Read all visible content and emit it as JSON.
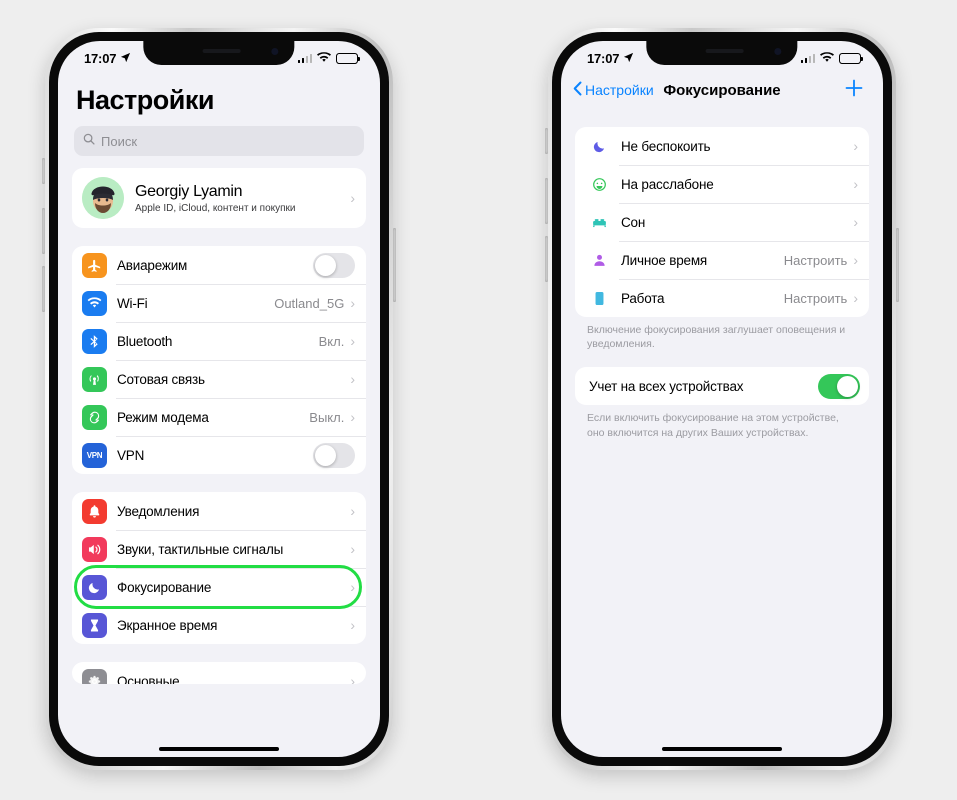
{
  "canvas": {
    "background": "#eeeeee"
  },
  "accent": {
    "blue": "#0a84ff",
    "green": "#34c759",
    "highlight": "#22dd44"
  },
  "phones": [
    {
      "id": "left",
      "status_bar": {
        "time": "17:07",
        "location_icon": "location-arrow-icon",
        "signal": "cellular-bars-icon",
        "wifi": "wifi-icon",
        "battery": "battery-icon"
      },
      "screen": {
        "title": "Настройки",
        "search": {
          "placeholder": "Поиск",
          "icon": "search-icon"
        },
        "profile": {
          "name": "Georgiy Lyamin",
          "subtitle": "Apple ID, iCloud, контент и покупки",
          "avatar": "memoji-avatar",
          "chevron": "›"
        },
        "groups": [
          {
            "name": "connectivity",
            "rows": [
              {
                "label": "Авиарежим",
                "icon": "airplane-icon",
                "icon_color": "#f7941e",
                "control": "toggle",
                "toggle_on": false
              },
              {
                "label": "Wi-Fi",
                "icon": "wifi-icon",
                "icon_color": "#1a7cf0",
                "value": "Outland_5G",
                "control": "chevron"
              },
              {
                "label": "Bluetooth",
                "icon": "bluetooth-icon",
                "icon_color": "#1a7cf0",
                "value": "Вкл.",
                "control": "chevron"
              },
              {
                "label": "Сотовая связь",
                "icon": "cellular-icon",
                "icon_color": "#34c759",
                "value": "",
                "control": "chevron"
              },
              {
                "label": "Режим модема",
                "icon": "hotspot-icon",
                "icon_color": "#34c759",
                "value": "Выкл.",
                "control": "chevron"
              },
              {
                "label": "VPN",
                "icon": "vpn-icon",
                "icon_color": "#2463d8",
                "control": "toggle",
                "toggle_on": false
              }
            ]
          },
          {
            "name": "notifications",
            "rows": [
              {
                "label": "Уведомления",
                "icon": "bell-icon",
                "icon_color": "#f33b30",
                "control": "chevron"
              },
              {
                "label": "Звуки, тактильные сигналы",
                "icon": "speaker-icon",
                "icon_color": "#f23a5c",
                "control": "chevron"
              },
              {
                "label": "Фокусирование",
                "icon": "moon-icon",
                "icon_color": "#5856d6",
                "control": "chevron",
                "highlighted": true
              },
              {
                "label": "Экранное время",
                "icon": "hourglass-icon",
                "icon_color": "#5856d6",
                "control": "chevron"
              }
            ]
          },
          {
            "name": "general-partial",
            "rows": [
              {
                "label": "Основные",
                "icon": "gear-icon",
                "icon_color": "#8e8e93",
                "control": "chevron"
              }
            ]
          }
        ]
      }
    },
    {
      "id": "right",
      "status_bar": {
        "time": "17:07",
        "location_icon": "location-arrow-icon",
        "signal": "cellular-bars-icon",
        "wifi": "wifi-icon",
        "battery": "battery-icon"
      },
      "screen": {
        "nav": {
          "back_label": "Настройки",
          "back_icon": "chevron-left-icon",
          "title": "Фокусирование",
          "add_label": "+",
          "add_icon": "plus-icon"
        },
        "focus_group": {
          "rows": [
            {
              "label": "Не беспокоить",
              "icon": "moon-icon",
              "icon_color": "#5e5ce6",
              "value": "",
              "control": "chevron"
            },
            {
              "label": "На расслабоне",
              "icon": "smiley-icon",
              "icon_color": "#34c759",
              "value": "",
              "control": "chevron"
            },
            {
              "label": "Сон",
              "icon": "bed-icon",
              "icon_color": "#2ec4b6",
              "value": "",
              "control": "chevron"
            },
            {
              "label": "Личное время",
              "icon": "person-icon",
              "icon_color": "#b05ce6",
              "value": "Настроить",
              "control": "chevron"
            },
            {
              "label": "Работа",
              "icon": "badge-icon",
              "icon_color": "#41b8e0",
              "value": "Настроить",
              "control": "chevron"
            }
          ]
        },
        "focus_footnote": "Включение фокусирования заглушает оповещения и уведомления.",
        "share_group": {
          "rows": [
            {
              "label": "Учет на всех устройствах",
              "control": "toggle",
              "toggle_on": true
            }
          ]
        },
        "share_footnote": "Если включить фокусирование на этом устройстве, оно включится на других Ваших устройствах."
      }
    }
  ]
}
